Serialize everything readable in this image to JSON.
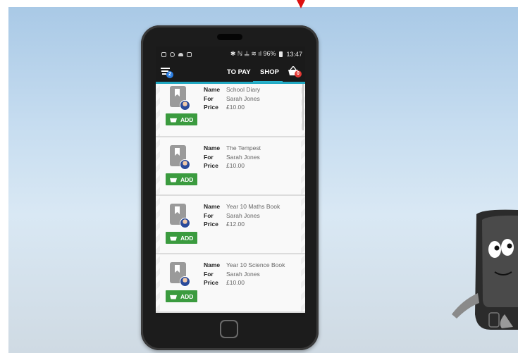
{
  "status_bar": {
    "left_icons": [
      "notification-icon",
      "alarm-icon",
      "cloud-icon",
      "image-icon"
    ],
    "right_text": "✱ ℕ 𝍦 ≋ ıl 96%",
    "battery": "96%",
    "time": "13:47"
  },
  "nav": {
    "filter_badge": "2",
    "tabs": [
      {
        "label": "TO PAY"
      },
      {
        "label": "SHOP"
      }
    ],
    "active_tab": "SHOP",
    "cart_badge": "0"
  },
  "items": [
    {
      "name_label": "Name",
      "name": "School Diary",
      "for_label": "For",
      "for": "Sarah Jones",
      "price_label": "Price",
      "price": "£10.00",
      "add_label": "ADD"
    },
    {
      "name_label": "Name",
      "name": "The Tempest",
      "for_label": "For",
      "for": "Sarah Jones",
      "price_label": "Price",
      "price": "£10.00",
      "add_label": "ADD"
    },
    {
      "name_label": "Name",
      "name": "Year 10 Maths Book",
      "for_label": "For",
      "for": "Sarah Jones",
      "price_label": "Price",
      "price": "£12.00",
      "add_label": "ADD"
    },
    {
      "name_label": "Name",
      "name": "Year 10 Science Book",
      "for_label": "For",
      "for": "Sarah Jones",
      "price_label": "Price",
      "price": "£10.00",
      "add_label": "ADD"
    }
  ],
  "colors": {
    "accent": "#21a8c2",
    "add_button": "#3b9b3f",
    "badge_blue": "#2a7de1",
    "badge_red": "#e53935"
  }
}
